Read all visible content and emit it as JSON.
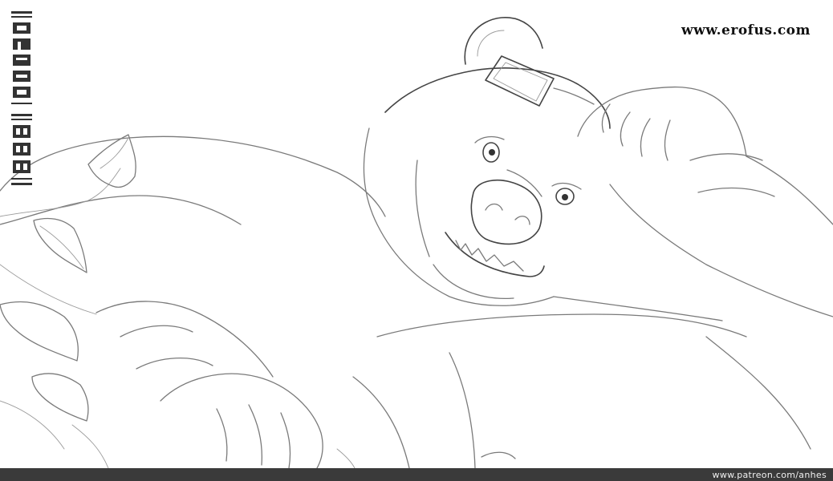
{
  "watermark": {
    "text": "www.erofus.com"
  },
  "footer": {
    "url": "www.patreon.com/anhes",
    "bar_color": "#3a3a3a"
  },
  "signature": {
    "artist_name": "anhes",
    "date": "2017 15"
  },
  "artwork": {
    "style": "line-art sketch",
    "line_color": "#7a7a7a",
    "background": "#ffffff"
  }
}
